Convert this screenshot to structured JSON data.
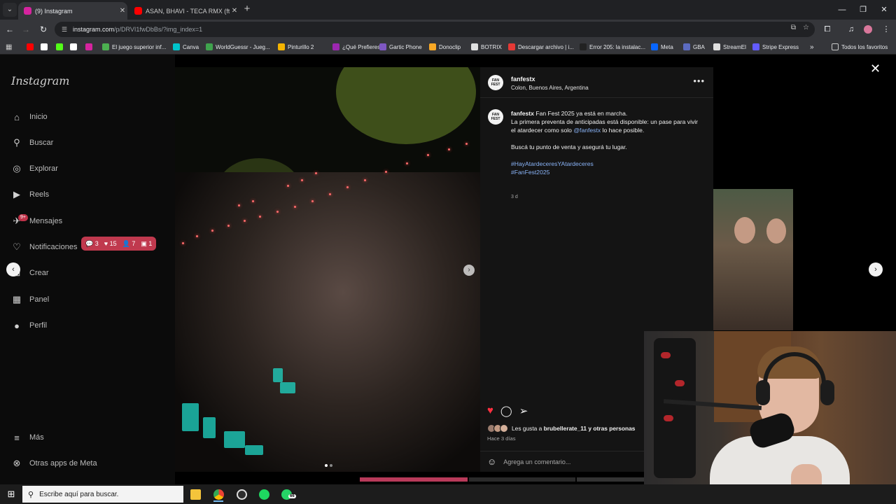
{
  "browser": {
    "tabs": [
      {
        "title": "(9) Instagram",
        "favicon_color": "#d6249f"
      },
      {
        "title": "ASAN, BHAVI - TECA RMX (ft. N",
        "favicon_color": "#ff0000"
      }
    ],
    "url_domain": "instagram.com",
    "url_path": "/p/DRVI1fwDbBs/?img_index=1",
    "bookmarks": [
      {
        "label": "",
        "color": "#ff0000"
      },
      {
        "label": "",
        "color": "#ffffff"
      },
      {
        "label": "",
        "color": "#53fc18"
      },
      {
        "label": "",
        "color": "#ffffff"
      },
      {
        "label": "",
        "color": "#d6249f"
      },
      {
        "label": "El juego superior inf...",
        "color": "#4caf50"
      },
      {
        "label": "Canva",
        "color": "#00c4cc"
      },
      {
        "label": "WorldGuessr - Jueg...",
        "color": "#3fa34d"
      },
      {
        "label": "Pinturillo 2",
        "color": "#f4b400"
      },
      {
        "label": "¿Qué Prefieres?",
        "color": "#9c27b0"
      },
      {
        "label": "Gartic Phone",
        "color": "#7e57c2"
      },
      {
        "label": "Donoclip",
        "color": "#f9a825"
      },
      {
        "label": "BOTRIX",
        "color": "#e0e0e0"
      },
      {
        "label": "Descargar archivo | i...",
        "color": "#e53935"
      },
      {
        "label": "Error 205: la instalac...",
        "color": "#222222"
      },
      {
        "label": "Meta",
        "color": "#0866ff"
      },
      {
        "label": "GBA",
        "color": "#5c6bc0"
      },
      {
        "label": "StreamEl",
        "color": "#e0e0e0"
      },
      {
        "label": "Stripe Express",
        "color": "#635bff"
      }
    ],
    "all_bookmarks": "Todos los favoritos"
  },
  "instagram": {
    "logo": "Instagram",
    "nav": [
      {
        "label": "Inicio",
        "icon": "home-icon",
        "glyph": "⌂"
      },
      {
        "label": "Buscar",
        "icon": "search-icon",
        "glyph": "⚲"
      },
      {
        "label": "Explorar",
        "icon": "compass-icon",
        "glyph": "◎"
      },
      {
        "label": "Reels",
        "icon": "reels-icon",
        "glyph": "▶"
      },
      {
        "label": "Mensajes",
        "icon": "messenger-icon",
        "glyph": "✈"
      },
      {
        "label": "Notificaciones",
        "icon": "heart-icon",
        "glyph": "♡"
      },
      {
        "label": "Crear",
        "icon": "plus-square-icon",
        "glyph": "⊞"
      },
      {
        "label": "Panel",
        "icon": "dashboard-icon",
        "glyph": "▦"
      },
      {
        "label": "Perfil",
        "icon": "profile-avatar-icon",
        "glyph": "●"
      }
    ],
    "messages_badge": "9+",
    "notification_pill": {
      "comments": "3",
      "likes": "15",
      "follows": "7",
      "tags": "1"
    },
    "more": "Más",
    "other_apps": "Otras apps de Meta",
    "post": {
      "username": "fanfestx",
      "location": "Colon, Buenos Aires, Argentina",
      "avatar_text": "FAN FEST",
      "caption_user": "fanfestx",
      "caption_line1": "Fan Fest 2025 ya está en marcha.",
      "caption_line2a": "La primera preventa de anticipadas está disponible: un pase para vivir el atardecer como solo",
      "caption_mention": "@fanfestx",
      "caption_line2b": "lo hace posible.",
      "caption_line3": "Buscá tu punto de venta y asegurá tu lugar.",
      "hashtag1": "#HayAtardeceresYAtardeceres",
      "hashtag2": "#FanFest2025",
      "caption_age": "3 d",
      "likes_prefix": "Les gusta a",
      "likes_user": "brubellerate_11",
      "likes_suffix": "y otras personas",
      "posted_when": "Hace 3 días",
      "comment_placeholder": "Agrega un comentario...",
      "carousel_index": 1,
      "carousel_count": 2
    }
  },
  "taskbar": {
    "search_placeholder": "Escribe aquí para buscar.",
    "whatsapp_badge": "66"
  }
}
